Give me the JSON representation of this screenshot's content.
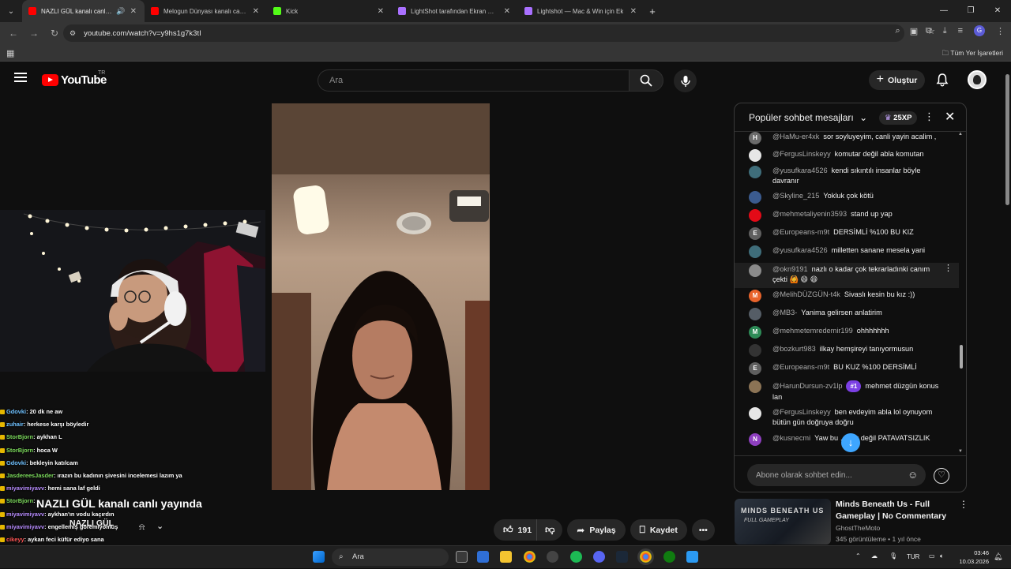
{
  "browser": {
    "tabs": [
      {
        "label": "NAZLI GÜL kanalı canlı ya",
        "favicon_color": "#ff0000",
        "active": true
      },
      {
        "label": "Melogun Dünyası kanalı canlı ya",
        "favicon_color": "#ff0000",
        "active": false
      },
      {
        "label": "Kick",
        "favicon_color": "#53fc18",
        "active": false
      },
      {
        "label": "LightShot tarafından Ekran Görü",
        "favicon_color": "#a970ff",
        "active": false
      },
      {
        "label": "Lightshot — Mac & Win için Ek",
        "favicon_color": "#a970ff",
        "active": false
      }
    ],
    "url": "youtube.com/watch?v=y9hs1g7k3tI",
    "bookmarks_label": "Tüm Yer İşaretleri"
  },
  "youtube": {
    "logo_text": "YouTube",
    "country_code": "TR",
    "search_placeholder": "Ara",
    "create_label": "Oluştur"
  },
  "video": {
    "title": "NAZLI GÜL kanalı canlı yayında",
    "channel_overlay": "NAZLI GÜL",
    "likes": "191",
    "share_label": "Paylaş",
    "save_label": "Kaydet"
  },
  "stream_chat": [
    {
      "user": "Gdovki",
      "text": ": 20 dk ne aw",
      "color": "#6fc1ff"
    },
    {
      "user": "zuhair",
      "text": ": herkese karşı böyledir",
      "color": "#6fc1ff"
    },
    {
      "user": "StorBjorn",
      "text": ": aykhan L",
      "color": "#7cdb5c"
    },
    {
      "user": "StorBjorn",
      "text": ": hoca W",
      "color": "#7cdb5c"
    },
    {
      "user": "Gdovki",
      "text": ": bekleyin katılcam",
      "color": "#6fc1ff"
    },
    {
      "user": "JasdereesJasder",
      "text": ": ırazın bu kadının şivesini incelemesi lazım ya",
      "color": "#7cdb5c"
    },
    {
      "user": "miyavimiyavv",
      "text": ": hemi sana laf geldi",
      "color": "#b88cff"
    },
    {
      "user": "StorBjorn",
      "text": ":",
      "color": "#7cdb5c"
    },
    {
      "user": "miyavimiyavv",
      "text": ": aykhan'ın vodu kaçırdın",
      "color": "#b88cff"
    },
    {
      "user": "miyavimiyavv",
      "text": ": engellemiş göremiyomuş",
      "color": "#b88cff"
    },
    {
      "user": "cikeyy",
      "text": ": aykan feci küfür ediyo sana",
      "color": "#ff5555"
    },
    {
      "user": "StorBjorn",
      "text": ": bi tutlu",
      "color": "#7cdb5c"
    }
  ],
  "live_chat": {
    "header_label": "Popüler sohbet mesajları",
    "xp_badge": "25XP",
    "input_placeholder": "Abone olarak sohbet edin...",
    "messages": [
      {
        "author": "@HaMu-er4xk",
        "text": "sor soyluyeyim, canli yayin acalim ,",
        "avatar_letter": "H",
        "avatar_color": "#6b6b6b"
      },
      {
        "author": "@FergusLinskeyy",
        "text": "komutar değil abla komutan",
        "avatar_letter": "",
        "avatar_color": "#e6e6e6"
      },
      {
        "author": "@yusufkara4526",
        "text": "kendi sıkıntılı insanlar böyle davranır",
        "avatar_letter": "",
        "avatar_color": "#3f6d7a"
      },
      {
        "author": "@Skyline_215",
        "text": "Yokluk çok kötü",
        "avatar_letter": "",
        "avatar_color": "#3b5b8f"
      },
      {
        "author": "@mehmetaliyenin3593",
        "text": "stand up yap",
        "avatar_letter": "",
        "avatar_color": "#e30a17"
      },
      {
        "author": "@Europeans-m9t",
        "text": "DERSİMLİ %100 BU KIZ",
        "avatar_letter": "E",
        "avatar_color": "#5f5f5f"
      },
      {
        "author": "@yusufkara4526",
        "text": "milletten sanane mesela yani",
        "avatar_letter": "",
        "avatar_color": "#3f6d7a"
      },
      {
        "author": "@okn9191",
        "text": "nazlı o kadar çok tekrarladınki canım çekti 🙆 😄 😄",
        "avatar_letter": "",
        "avatar_color": "#8a8a8a"
      },
      {
        "author": "@MelihDÜZGÜN-t4k",
        "text": "Sivaslı kesin bu kız :))",
        "avatar_letter": "M",
        "avatar_color": "#e8632b"
      },
      {
        "author": "@MB3-",
        "text": "Yanima gelirsen anlatirim",
        "avatar_letter": "",
        "avatar_color": "#555d66"
      },
      {
        "author": "@mehmetemredemir199",
        "text": "ohhhhhhh",
        "avatar_letter": "M",
        "avatar_color": "#2e8b57"
      },
      {
        "author": "@bozkurt983",
        "text": "ilkay hemşireyi tanıyormusun",
        "avatar_letter": "",
        "avatar_color": "#333333"
      },
      {
        "author": "@Europeans-m9t",
        "text": "BU KUZ %100 DERSİMLİ",
        "avatar_letter": "E",
        "avatar_color": "#5f5f5f"
      },
      {
        "author": "@HarunDursun-zv1lp",
        "text": "mehmet düzgün konus lan",
        "avatar_letter": "",
        "avatar_color": "#8b7355",
        "badge": "#1"
      },
      {
        "author": "@FergusLinskeyy",
        "text": "ben evdeyim abla lol oynuyom bütün gün doğruya doğru",
        "avatar_letter": "",
        "avatar_color": "#e6e6e6"
      },
      {
        "author": "@kusnecmi",
        "text": "Yaw bu …tlük değil PATAVATSIZLIK",
        "avatar_letter": "N",
        "avatar_color": "#8e3fbf"
      }
    ]
  },
  "recommendation": {
    "thumb_title": "MINDS BENEATH US",
    "thumb_sub": "FULL GAMEPLAY",
    "title": "Minds Beneath Us - Full Gameplay | No Commentary",
    "channel": "GhostTheMoto",
    "views": "345 görüntüleme",
    "age": "1 yıl önce"
  },
  "taskbar": {
    "search_label": "Ara",
    "language": "TUR",
    "time": "03:46",
    "date": "10.03.2026"
  }
}
